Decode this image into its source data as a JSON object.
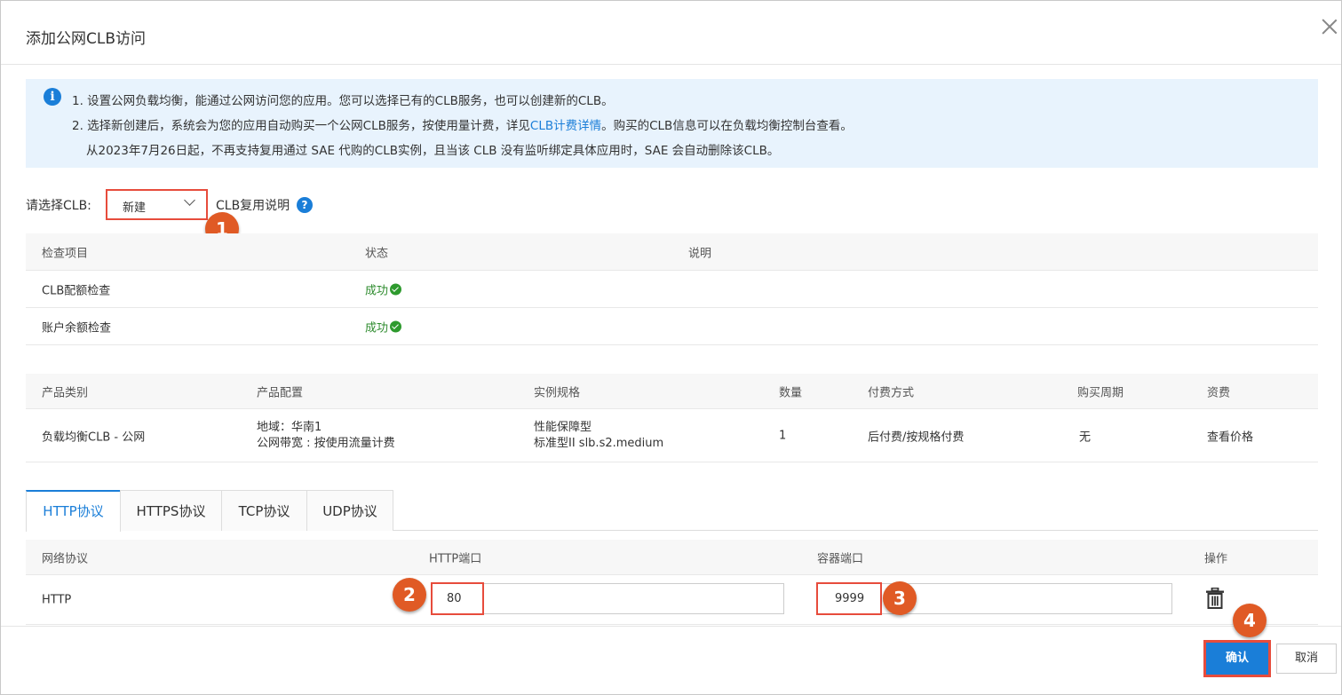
{
  "dialog": {
    "title": "添加公网CLB访问"
  },
  "notice": {
    "line1": "1. 设置公网负载均衡，能通过公网访问您的应用。您可以选择已有的CLB服务，也可以创建新的CLB。",
    "line2_prefix": "2. 选择新创建后，系统会为您的应用自动购买一个公网CLB服务，按使用量计费，详见",
    "line2_link": "CLB计费详情",
    "line2_suffix": "。购买的CLB信息可以在负载均衡控制台查看。",
    "line3": "从2023年7月26日起，不再支持复用通过 SAE 代购的CLB实例，且当该 CLB 没有监听绑定具体应用时，SAE 会自动删除该CLB。"
  },
  "clb_select": {
    "label": "请选择CLB:",
    "value": "新建",
    "reuse_label": "CLB复用说明"
  },
  "badges": [
    "1",
    "2",
    "3",
    "4"
  ],
  "check_table": {
    "headers": [
      "检查项目",
      "状态",
      "说明"
    ],
    "rows": [
      {
        "item": "CLB配额检查",
        "status": "成功",
        "desc": ""
      },
      {
        "item": "账户余额检查",
        "status": "成功",
        "desc": ""
      }
    ]
  },
  "product_table": {
    "headers": [
      "产品类别",
      "产品配置",
      "实例规格",
      "数量",
      "付费方式",
      "购买周期",
      "资费"
    ],
    "row": {
      "category": "负载均衡CLB - 公网",
      "config_line1": "地域：华南1",
      "config_line2": "公网带宽 : 按使用流量计费",
      "spec_line1": "性能保障型",
      "spec_line2": "标准型II slb.s2.medium",
      "quantity": "1",
      "payment": "后付费/按规格付费",
      "period": "无",
      "price_link": "查看价格"
    }
  },
  "protocol_tabs": [
    "HTTP协议",
    "HTTPS协议",
    "TCP协议",
    "UDP协议"
  ],
  "port_table": {
    "headers": [
      "网络协议",
      "HTTP端口",
      "容器端口",
      "操作"
    ],
    "row": {
      "protocol": "HTTP",
      "http_port": "80",
      "container_port": "9999"
    }
  },
  "footer": {
    "confirm": "确认",
    "cancel": "取消"
  },
  "colors": {
    "primary": "#1a7ed8",
    "highlight": "#e74c3c",
    "badge": "#e05a25",
    "success": "#2e8b2e",
    "notice_bg": "#e8f3fd"
  },
  "icons": [
    "close-icon",
    "info-icon",
    "chevron-down-icon",
    "help-icon",
    "check-circle-icon",
    "trash-icon"
  ]
}
